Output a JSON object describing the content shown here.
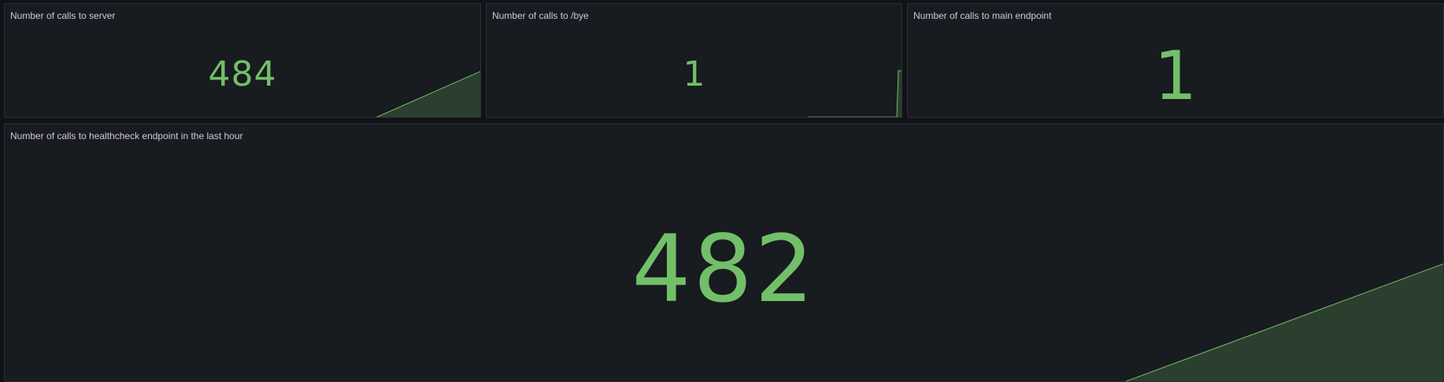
{
  "dashboard": {
    "panels": [
      {
        "title": "Number of calls to server",
        "value": "484",
        "color": "#73bf69",
        "sparkline": "rising"
      },
      {
        "title": "Number of calls to /bye",
        "value": "1",
        "color": "#73bf69",
        "sparkline": "step"
      },
      {
        "title": "Number of calls to main endpoint",
        "value": "1",
        "color": "#73bf69",
        "sparkline": "none"
      },
      {
        "title": "Number of calls to healthcheck endpoint in the last hour",
        "value": "482",
        "color": "#73bf69",
        "sparkline": "rising"
      }
    ]
  }
}
